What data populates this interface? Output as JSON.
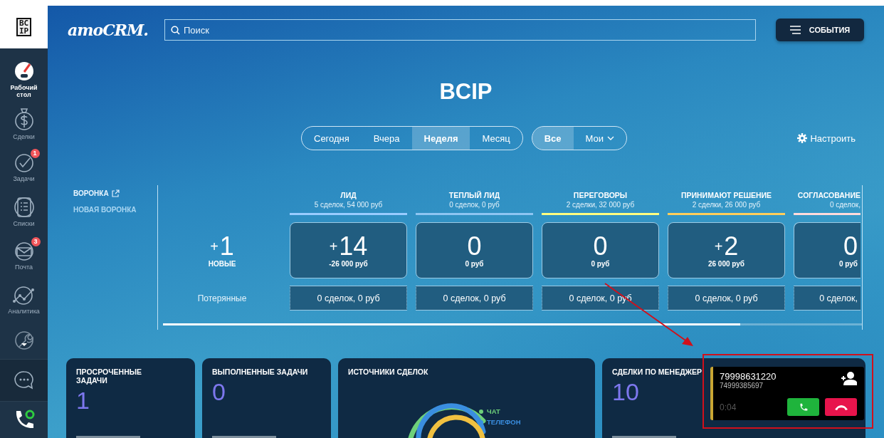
{
  "sidebar": {
    "logo": [
      "BC",
      "IP"
    ],
    "items": [
      {
        "label": "Рабочий стол",
        "kind": "dashboard",
        "selected": true
      },
      {
        "label": "Сделки",
        "kind": "deals",
        "selected": false
      },
      {
        "label": "Задачи",
        "kind": "tasks",
        "badge": "1",
        "selected": false
      },
      {
        "label": "Списки",
        "kind": "lists",
        "selected": false
      },
      {
        "label": "Почта",
        "kind": "mail",
        "badge": "3",
        "selected": false
      },
      {
        "label": "Аналитика",
        "kind": "analytics",
        "selected": false
      }
    ]
  },
  "header": {
    "logo": "amoCRM.",
    "search": {
      "placeholder": "Поиск"
    },
    "events_button": "СОБЫТИЯ"
  },
  "title": "BCIP",
  "period_tabs": [
    {
      "label": "Сегодня",
      "selected": false
    },
    {
      "label": "Вчера",
      "selected": false
    },
    {
      "label": "Неделя",
      "selected": true
    },
    {
      "label": "Месяц",
      "selected": false
    }
  ],
  "owner_tabs": [
    {
      "label": "Все",
      "selected": true,
      "dropdown": false
    },
    {
      "label": "Мои",
      "selected": false,
      "dropdown": true
    }
  ],
  "settings_link": "Настроить",
  "pipelines": [
    {
      "label": "ВОРОНКА",
      "selected": true
    },
    {
      "label": "НОВАЯ ВОРОНКА",
      "selected": false
    }
  ],
  "new_leads": {
    "sign": "+",
    "count": "1",
    "label": "НОВЫЕ"
  },
  "lost_label": "Потерянные",
  "stages": [
    {
      "name": "ЛИД",
      "summary": "5 сделок, 54 000 руб",
      "color": "#99ccff",
      "sign": "+",
      "count": "14",
      "amount": "-26 000 руб",
      "lost": "0 сделок, 0 руб"
    },
    {
      "name": "ТЕПЛЫЙ ЛИД",
      "summary": "0 сделок, 0 руб",
      "color": "#8ec5f2",
      "count": "0",
      "amount": "0 руб",
      "lost": "0 сделок, 0 руб"
    },
    {
      "name": "ПЕРЕГОВОРЫ",
      "summary": "2 сделки, 32 000 руб",
      "color": "#fffd7f",
      "count": "0",
      "amount": "0 руб",
      "lost": "0 сделок, 0 руб"
    },
    {
      "name": "ПРИНИМАЮТ РЕШЕНИЕ",
      "summary": "2 сделки, 26 000 руб",
      "color": "#ffce5a",
      "sign": "+",
      "count": "2",
      "amount": "26 000 руб",
      "lost": "0 сделок, 0 руб"
    },
    {
      "name": "СОГЛАСОВАНИЕ",
      "summary": "0 сделок,",
      "color": "#ffdbdb",
      "count": "0",
      "amount": "0 руб",
      "lost": "0 сделок,"
    }
  ],
  "widgets": [
    {
      "kind": "counter",
      "title": "ПРОСРОЧЕННЫЕ ЗАДАЧИ",
      "value": "1"
    },
    {
      "kind": "counter",
      "title": "ВЫПОЛНЕННЫЕ ЗАДАЧИ",
      "value": "0"
    },
    {
      "kind": "sources",
      "title": "ИСТОЧНИКИ СДЕЛОК",
      "legend": [
        {
          "label": "ЧАТ",
          "color": "#6ed07a"
        },
        {
          "label": "ТЕЛЕФОН",
          "color": "#3a8ee0"
        }
      ]
    },
    {
      "kind": "counter",
      "title": "СДЕЛКИ ПО МЕНЕДЖЕР",
      "value": "10"
    }
  ],
  "call": {
    "number": "79998631220",
    "line": "74999385697",
    "duration": "0:04"
  },
  "annotation": {
    "arrow": true,
    "box": true
  }
}
